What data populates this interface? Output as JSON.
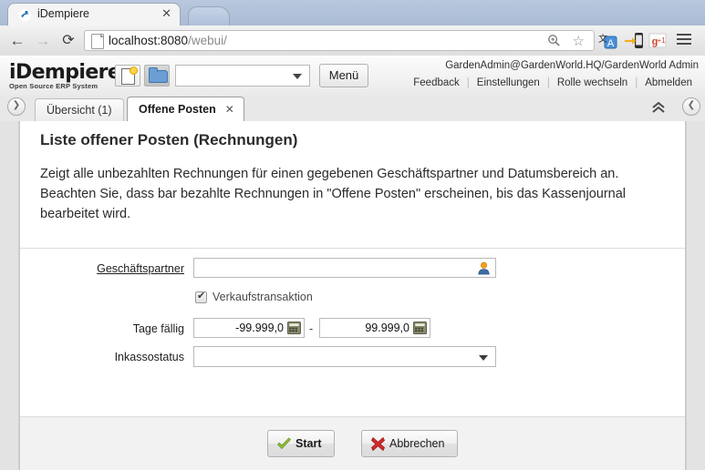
{
  "browser": {
    "tab_title": "iDempiere",
    "tab_close": "✕",
    "favicon": "idempiere-favicon-icon",
    "new_tab": "new-tab-button",
    "back": "◀",
    "forward": "▶",
    "reload": "⟳",
    "url_host": "localhost:8080",
    "url_path": "/webui/",
    "url_full": "localhost:8080/webui/",
    "zoom_icon": "🔍",
    "star_icon": "☆",
    "extensions": [
      "translate-icon",
      "send-to-phone-icon",
      "google-plus-one-icon"
    ],
    "menu_icon": "hamburger-menu-icon"
  },
  "header": {
    "logo_main": "iDempiere",
    "logo_sub": "Open Source ERP System",
    "new_icon": "new-record-icon",
    "open_icon": "open-folder-icon",
    "select_value": "",
    "menu_button": "Menü",
    "user": "GardenAdmin@GardenWorld.HQ/GardenWorld Admin",
    "links": [
      "Feedback",
      "Einstellungen",
      "Rolle wechseln",
      "Abmelden"
    ]
  },
  "tabbar": {
    "left_toggle": "❯",
    "right_toggle": "❮",
    "collapse_icon": "⌃⌃",
    "tabs": [
      {
        "label": "Übersicht (1)",
        "active": false
      },
      {
        "label": "Offene Posten",
        "active": true,
        "close": "✕"
      }
    ]
  },
  "form": {
    "title": "Liste offener Posten (Rechnungen)",
    "description": "Zeigt alle unbezahlten Rechnungen für einen gegebenen Geschäftspartner und Datumsbereich an. Beachten Sie, dass bar bezahlte Rechnungen in \"Offene Posten\" erscheinen, bis das Kassenjournal bearbeitet wird.",
    "fields": {
      "business_partner": {
        "label": "Geschäftspartner",
        "value": "",
        "icon": "business-partner-lookup-icon"
      },
      "sales_transaction": {
        "label": "Verkaufstransaktion",
        "checked": true
      },
      "days_due": {
        "label": "Tage fällig",
        "from": "-99.999,0",
        "to": "99.999,0",
        "separator": "-",
        "icon": "calculator-icon"
      },
      "dunning_status": {
        "label": "Inkassostatus",
        "value": "",
        "caret": "▼"
      }
    },
    "buttons": {
      "start": {
        "label": "Start",
        "icon": "green-check-icon"
      },
      "cancel": {
        "label": "Abbrechen",
        "icon": "red-x-icon"
      }
    }
  },
  "colors": {
    "chrome_tabstrip": "#b0c0d8",
    "accent_blue": "#3f74ad",
    "start_green": "#8dbf3c",
    "cancel_red": "#cc2222",
    "panel_bg": "#ffffff",
    "content_bg": "#d9d9d9"
  }
}
